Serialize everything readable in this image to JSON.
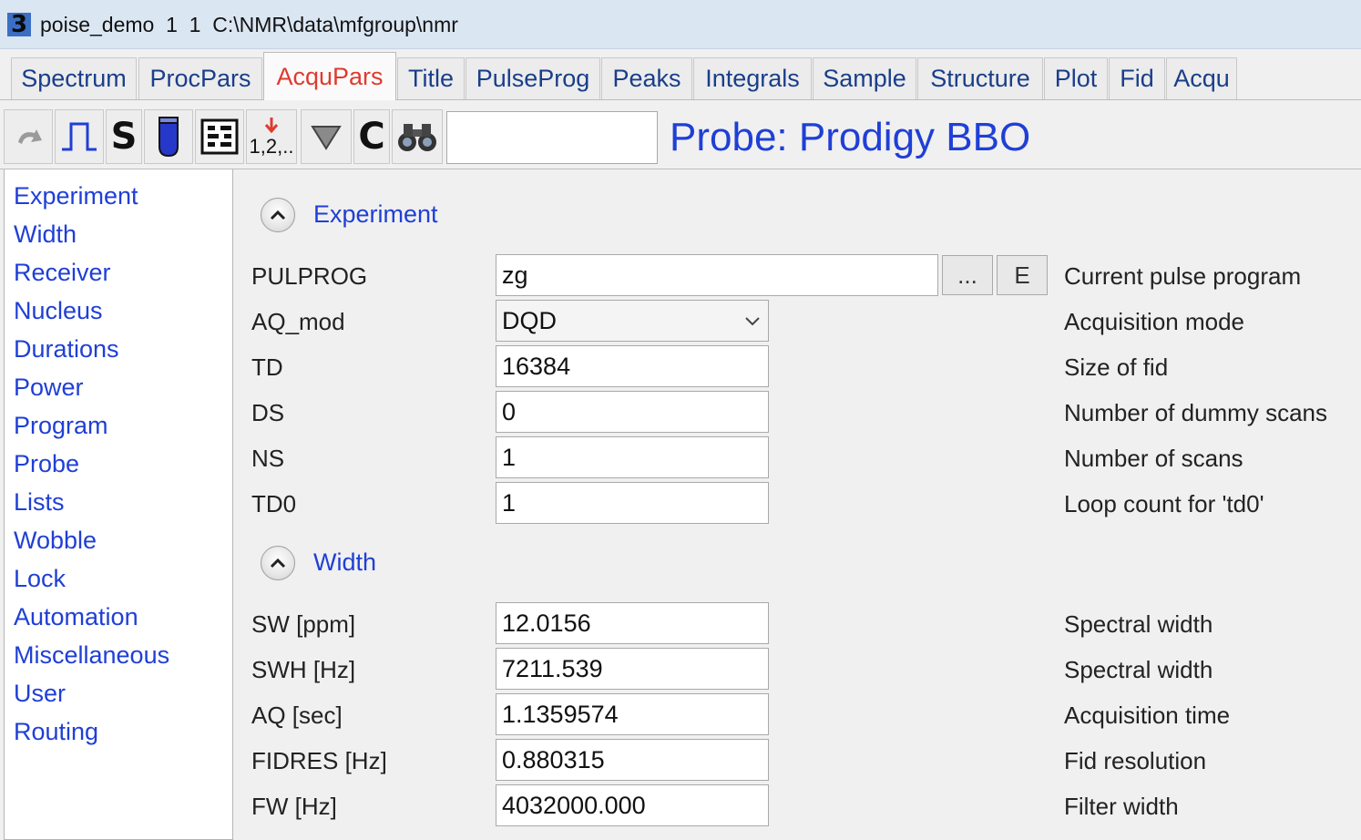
{
  "window": {
    "app_icon": "3",
    "title": "poise_demo  1  1  C:\\NMR\\data\\mfgroup\\nmr"
  },
  "tabs": [
    "Spectrum",
    "ProcPars",
    "AcquPars",
    "Title",
    "PulseProg",
    "Peaks",
    "Integrals",
    "Sample",
    "Structure",
    "Plot",
    "Fid",
    "Acqu"
  ],
  "active_tab": "AcquPars",
  "toolbar": {
    "icons": [
      "undo-icon",
      "pulse-icon",
      "s-icon",
      "tube-icon",
      "table-icon",
      "numbering-icon",
      "filter-icon",
      "c-icon",
      "binoculars-icon"
    ],
    "s_label": "S",
    "c_label": "C",
    "numbering_label": "1,2,..",
    "search_value": "",
    "probe": "Probe: Prodigy BBO"
  },
  "sidebar": {
    "items": [
      "Experiment",
      "Width",
      "Receiver",
      "Nucleus",
      "Durations",
      "Power",
      "Program",
      "Probe",
      "Lists",
      "Wobble",
      "Lock",
      "Automation",
      "Miscellaneous",
      "User",
      "Routing"
    ]
  },
  "sections": {
    "experiment": {
      "title": "Experiment",
      "params": [
        {
          "label": "PULPROG",
          "value": "zg",
          "desc": "Current pulse program"
        },
        {
          "label": "AQ_mod",
          "value": "DQD",
          "desc": "Acquisition mode"
        },
        {
          "label": "TD",
          "value": "16384",
          "desc": "Size of fid"
        },
        {
          "label": "DS",
          "value": "0",
          "desc": "Number of dummy scans"
        },
        {
          "label": "NS",
          "value": "1",
          "desc": "Number of scans"
        },
        {
          "label": "TD0",
          "value": "1",
          "desc": "Loop count for 'td0'"
        }
      ],
      "browse_label": "...",
      "edit_label": "E"
    },
    "width": {
      "title": "Width",
      "params": [
        {
          "label": "SW [ppm]",
          "value": "12.0156",
          "desc": "Spectral width"
        },
        {
          "label": "SWH [Hz]",
          "value": "7211.539",
          "desc": "Spectral width"
        },
        {
          "label": "AQ [sec]",
          "value": "1.1359574",
          "desc": "Acquisition time"
        },
        {
          "label": "FIDRES [Hz]",
          "value": "0.880315",
          "desc": "Fid resolution"
        },
        {
          "label": "FW [Hz]",
          "value": "4032000.000",
          "desc": "Filter width"
        }
      ]
    }
  },
  "colors": {
    "link_blue": "#1f3fd6",
    "active_tab_red": "#e03a2e",
    "titlebar": "#dbe6f3"
  }
}
